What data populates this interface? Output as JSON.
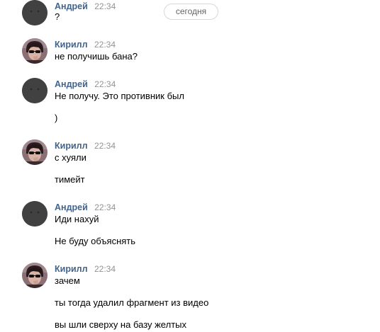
{
  "date_divider": "сегодня",
  "groups": [
    {
      "author": "Андрей",
      "avatar": "dark-avatar",
      "time": "22:34",
      "messages": [
        "?"
      ]
    },
    {
      "author": "Кирилл",
      "avatar": "photo-avatar",
      "time": "22:34",
      "messages": [
        "не получишь бана?"
      ]
    },
    {
      "author": "Андрей",
      "avatar": "dark-avatar",
      "time": "22:34",
      "messages": [
        "Не получу. Это противник был",
        ")"
      ]
    },
    {
      "author": "Кирилл",
      "avatar": "photo-avatar",
      "time": "22:34",
      "messages": [
        "с хуяли",
        "тимейт"
      ]
    },
    {
      "author": "Андрей",
      "avatar": "dark-avatar",
      "time": "22:34",
      "messages": [
        "Иди нахуй",
        "Не буду объяснять"
      ]
    },
    {
      "author": "Кирилл",
      "avatar": "photo-avatar",
      "time": "22:34",
      "messages": [
        "зачем",
        "ты тогда удалил фрагмент из видео",
        "вы шли сверху на базу желтых"
      ]
    }
  ],
  "colors": {
    "author_link": "#42648b",
    "time": "#939393",
    "text": "#000000",
    "pill_border": "#d3d9de"
  }
}
